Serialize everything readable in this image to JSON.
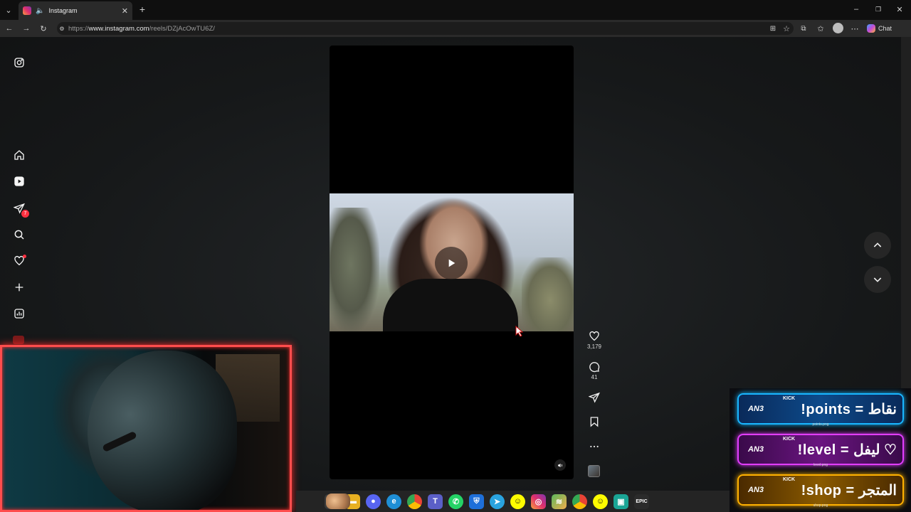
{
  "browser": {
    "tab_title": "Instagram",
    "url_prefix": "https://",
    "url_host": "www.instagram.com",
    "url_path": "/reels/DZjAcOwTU6Z/",
    "chat_label": "Chat"
  },
  "sidebar": {
    "items": [
      {
        "name": "instagram-logo-icon"
      },
      {
        "name": "home-icon"
      },
      {
        "name": "reels-icon"
      },
      {
        "name": "messages-icon",
        "badge": "7"
      },
      {
        "name": "search-icon"
      },
      {
        "name": "notifications-icon"
      },
      {
        "name": "create-icon"
      },
      {
        "name": "dashboard-icon"
      }
    ]
  },
  "reel": {
    "likes": "3,179",
    "comments": "41"
  },
  "kick": {
    "panels": [
      {
        "tag": "KICK",
        "logo": "AN3",
        "command": "!points = نقاط",
        "caption": "points.png",
        "color": "#19b6ff"
      },
      {
        "tag": "KICK",
        "logo": "AN3",
        "command": "!level = ليفل ♡",
        "caption": "level.png",
        "color": "#e23dff"
      },
      {
        "tag": "KICK",
        "logo": "AN3",
        "command": "!shop = المتجر",
        "caption": "shop.png",
        "color": "#ffb100"
      }
    ]
  }
}
